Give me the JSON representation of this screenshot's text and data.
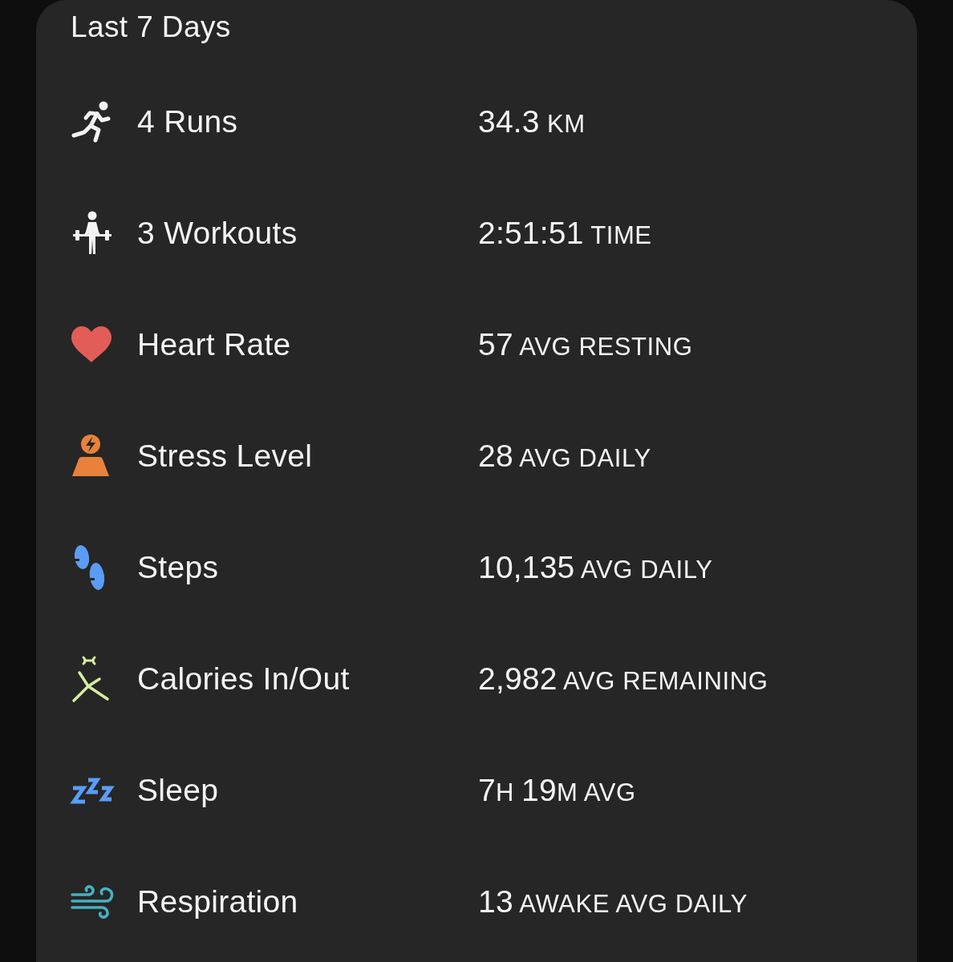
{
  "card": {
    "title": "Last 7 Days",
    "rows": [
      {
        "kind": "run",
        "label": "4 Runs",
        "value": [
          {
            "kind": "number",
            "text": "34.3"
          },
          {
            "kind": "unit",
            "text": " KM"
          }
        ]
      },
      {
        "kind": "workout",
        "label": "3 Workouts",
        "value": [
          {
            "kind": "number",
            "text": "2:51:51"
          },
          {
            "kind": "unit",
            "text": " TIME"
          }
        ]
      },
      {
        "kind": "heart",
        "label": "Heart Rate",
        "value": [
          {
            "kind": "number",
            "text": "57"
          },
          {
            "kind": "unit",
            "text": " AVG RESTING"
          }
        ]
      },
      {
        "kind": "stress",
        "label": "Stress Level",
        "value": [
          {
            "kind": "number",
            "text": "28"
          },
          {
            "kind": "unit",
            "text": " AVG DAILY"
          }
        ]
      },
      {
        "kind": "steps",
        "label": "Steps",
        "value": [
          {
            "kind": "number",
            "text": "10,135"
          },
          {
            "kind": "unit",
            "text": " AVG DAILY"
          }
        ]
      },
      {
        "kind": "calories",
        "label": "Calories In/Out",
        "value": [
          {
            "kind": "number",
            "text": "2,982"
          },
          {
            "kind": "unit",
            "text": " AVG REMAINING"
          }
        ]
      },
      {
        "kind": "sleep",
        "label": "Sleep",
        "value": [
          {
            "kind": "number",
            "text": "7"
          },
          {
            "kind": "unit",
            "text": "H "
          },
          {
            "kind": "number",
            "text": "19"
          },
          {
            "kind": "unit",
            "text": "M AVG"
          }
        ]
      },
      {
        "kind": "respiration",
        "label": "Respiration",
        "value": [
          {
            "kind": "number",
            "text": "13"
          },
          {
            "kind": "unit",
            "text": " AWAKE AVG DAILY"
          }
        ]
      }
    ]
  }
}
